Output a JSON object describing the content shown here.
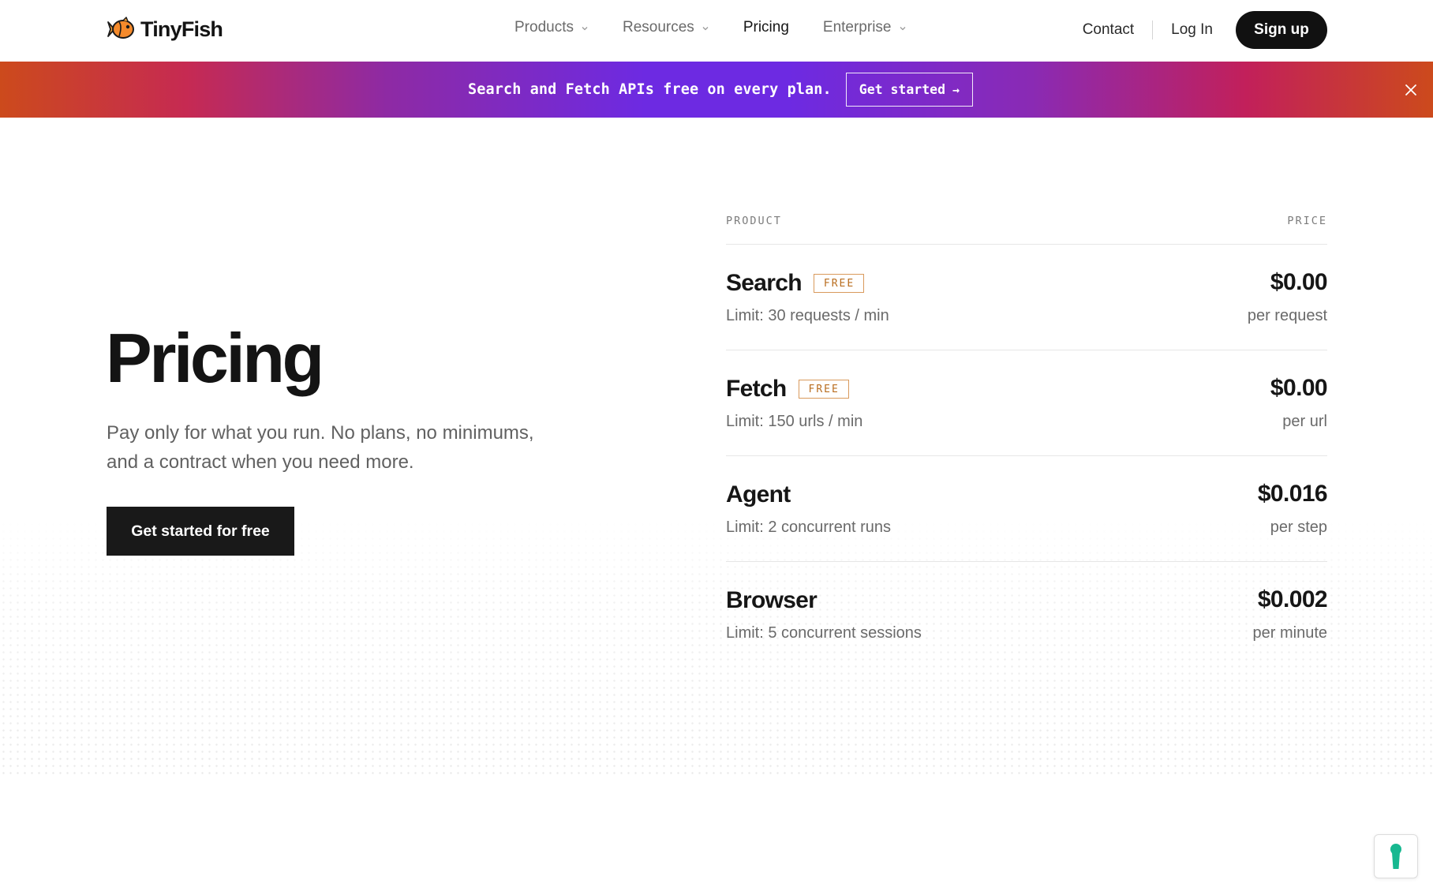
{
  "brand": {
    "name": "TinyFish"
  },
  "nav": {
    "links": [
      {
        "label": "Products",
        "has_dropdown": true
      },
      {
        "label": "Resources",
        "has_dropdown": true
      },
      {
        "label": "Pricing",
        "has_dropdown": false,
        "active": true
      },
      {
        "label": "Enterprise",
        "has_dropdown": true
      }
    ],
    "contact": "Contact",
    "login": "Log In",
    "signup": "Sign up"
  },
  "banner": {
    "text": "Search and Fetch APIs free on every plan.",
    "button_label": "Get started",
    "button_arrow": "→",
    "close_icon": "close-icon"
  },
  "hero": {
    "title": "Pricing",
    "subtitle_line1": "Pay only for what you run. No plans, no minimums,",
    "subtitle_line2": "and a contract when you need more.",
    "cta": "Get started for free"
  },
  "pricing_table": {
    "headers": {
      "product": "PRODUCT",
      "price": "PRICE"
    },
    "rows": [
      {
        "name": "Search",
        "badge": "FREE",
        "limit": "Limit: 30 requests / min",
        "price": "$0.00",
        "unit": "per request"
      },
      {
        "name": "Fetch",
        "badge": "FREE",
        "limit": "Limit: 150 urls / min",
        "price": "$0.00",
        "unit": "per url"
      },
      {
        "name": "Agent",
        "badge": "",
        "limit": "Limit: 2 concurrent runs",
        "price": "$0.016",
        "unit": "per step"
      },
      {
        "name": "Browser",
        "badge": "",
        "limit": "Limit: 5 concurrent sessions",
        "price": "$0.002",
        "unit": "per minute"
      }
    ]
  },
  "colors": {
    "banner_gradient": [
      "#cc4a1c",
      "#c62a52",
      "#6d2ae2",
      "#c2205a"
    ],
    "badge_accent": "#b96d1f",
    "primary_button": "#111111",
    "widget_icon": "#17b890"
  },
  "widget": {
    "icon": "keyhole-icon"
  }
}
